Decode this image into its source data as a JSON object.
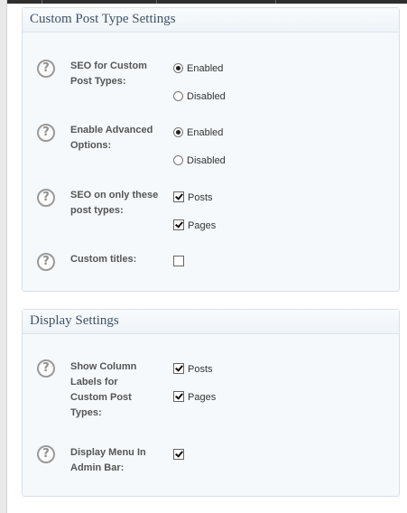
{
  "panels": {
    "custom_post_type": {
      "title": "Custom Post Type Settings",
      "rows": [
        {
          "label": "SEO for Custom Post Types:",
          "options": [
            {
              "type": "radio",
              "label": "Enabled",
              "checked": true
            },
            {
              "type": "radio",
              "label": "Disabled",
              "checked": false
            }
          ]
        },
        {
          "label": "Enable Advanced Options:",
          "options": [
            {
              "type": "radio",
              "label": "Enabled",
              "checked": true
            },
            {
              "type": "radio",
              "label": "Disabled",
              "checked": false
            }
          ]
        },
        {
          "label": "SEO on only these post types:",
          "options": [
            {
              "type": "checkbox",
              "label": "Posts",
              "checked": true
            },
            {
              "type": "checkbox",
              "label": "Pages",
              "checked": true
            }
          ]
        },
        {
          "label": "Custom titles:",
          "options": [
            {
              "type": "checkbox",
              "label": "",
              "checked": false
            }
          ]
        }
      ]
    },
    "display": {
      "title": "Display Settings",
      "rows": [
        {
          "label": "Show Column Labels for Custom Post Types:",
          "options": [
            {
              "type": "checkbox",
              "label": "Posts",
              "checked": true
            },
            {
              "type": "checkbox",
              "label": "Pages",
              "checked": true
            }
          ]
        },
        {
          "label": "Display Menu In Admin Bar:",
          "options": [
            {
              "type": "checkbox",
              "label": "",
              "checked": true
            }
          ]
        }
      ]
    }
  },
  "help_icon_text": "?",
  "colors": {
    "panel_bg": "#f5f9fc",
    "panel_border": "#d8e0e6",
    "panel_title": "#3f5166",
    "label_text": "#555555"
  }
}
